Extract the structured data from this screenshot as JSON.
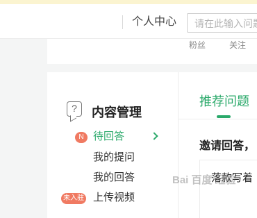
{
  "header": {
    "user_center": "个人中心",
    "search_placeholder": "请在此输入问题"
  },
  "profile": {
    "stats": [
      "粉丝",
      "关注"
    ]
  },
  "sidebar": {
    "title": "内容管理",
    "items": [
      {
        "label": "待回答",
        "badge": "N",
        "active": true
      },
      {
        "label": "我的提问"
      },
      {
        "label": "我的回答"
      },
      {
        "label": "上传视频",
        "badge": "未入驻"
      }
    ]
  },
  "main": {
    "tab_active": "推荐问题",
    "invite_heading": "邀请回答，",
    "question_card": "落款写着"
  },
  "watermark": "Bai 百度 经验",
  "colors": {
    "accent": "#2aa96a",
    "badge": "#f07a62"
  }
}
